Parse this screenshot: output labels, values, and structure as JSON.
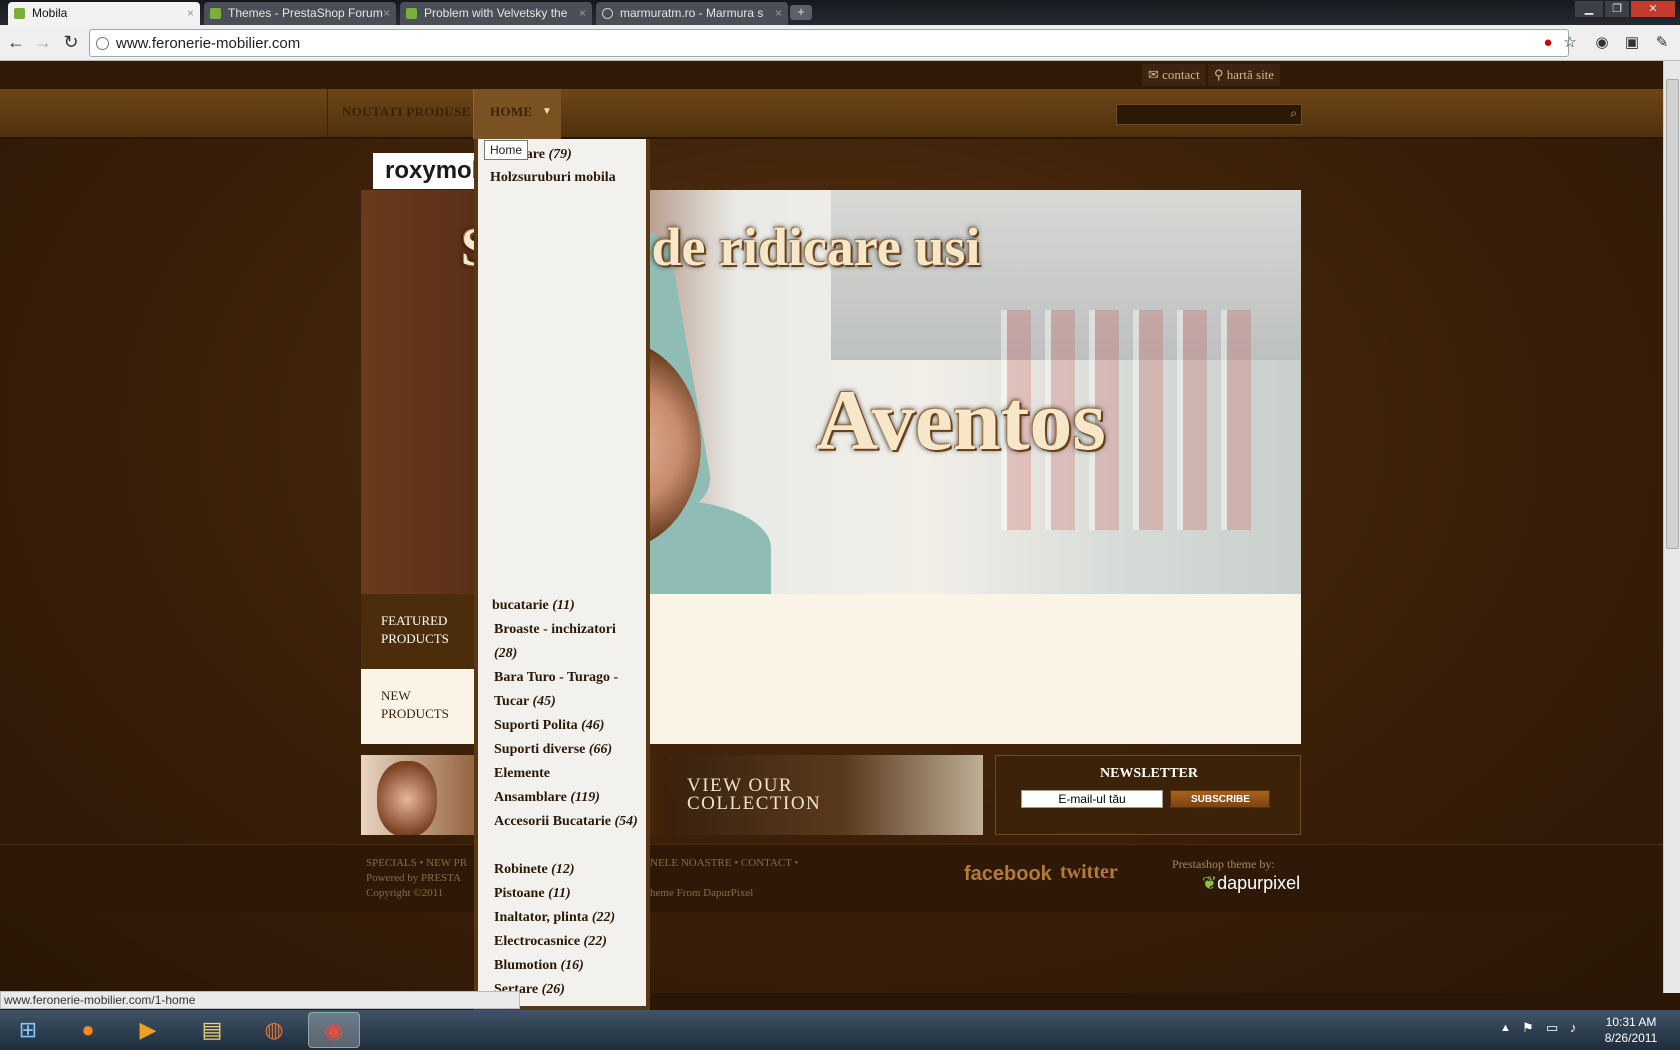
{
  "browser": {
    "tabs": [
      {
        "label": "Mobila",
        "active": true
      },
      {
        "label": "Themes - PrestaShop Forum",
        "active": false
      },
      {
        "label": "Problem with Velvetsky the",
        "active": false
      },
      {
        "label": "marmuratm.ro - Marmura s",
        "active": false
      }
    ],
    "new_tab": "+",
    "url": "www.feronerie-mobilier.com",
    "status_url": "www.feronerie-mobilier.com/1-home"
  },
  "site": {
    "top_links": [
      "contact",
      "hartă site"
    ],
    "menu": {
      "first_item": "NOUTATI PRODUSE",
      "home": "HOME"
    },
    "tooltip": "Home",
    "logo": "roxymob",
    "banner": {
      "title": "Sisteme de ridicare usi",
      "brand": "Aventos"
    },
    "product_tabs": [
      "FEATURED PRODUCTS",
      "NEW PRODUCTS"
    ],
    "promo": {
      "collection": "VIEW OUR COLLECTION"
    },
    "newsletter": {
      "title": "NEWSLETTER",
      "placeholder": "E-mail-ul tău",
      "button": "SUBSCRIBE"
    },
    "dropdown": [
      {
        "label": "Mobilare",
        "count": "(79)"
      },
      {
        "label": "Holzsuruburi mobila",
        "count": ""
      },
      {
        "label": "bucatarie",
        "count": "(11)"
      },
      {
        "label": "Broaste - inchizatori",
        "count": "(28)"
      },
      {
        "label": "Bara Turo - Turago - Tucar",
        "count": "(45)"
      },
      {
        "label": "Suporti Polita",
        "count": "(46)"
      },
      {
        "label": "Suporti diverse",
        "count": "(66)"
      },
      {
        "label": "Elemente Ansamblare",
        "count": "(119)"
      },
      {
        "label": "Accesorii Bucatarie",
        "count": "(54)"
      },
      {
        "label": "Robinete",
        "count": "(12)"
      },
      {
        "label": "Pistoane",
        "count": "(11)"
      },
      {
        "label": "Inaltator, plinta",
        "count": "(22)"
      },
      {
        "label": "Electrocasnice",
        "count": "(22)"
      },
      {
        "label": "Blumotion",
        "count": "(16)"
      },
      {
        "label": "Sertare",
        "count": "(26)"
      }
    ],
    "footer": {
      "links": "SPECIALS • NEW PR",
      "links_right": "NELE NOASTRE • CONTACT •",
      "powered": "Powered by PRESTA",
      "copyright": "Copyright ©2011",
      "theme": "heme From DapurPixel",
      "social_fb": "facebook",
      "social_tw": "twitter",
      "byline": "Prestashop theme by:",
      "brand": "dapurpixel"
    }
  },
  "taskbar": {
    "time": "10:31 AM",
    "date": "8/26/2011"
  },
  "colors": {
    "accent": "#5a3812",
    "background": "#2a1606"
  }
}
